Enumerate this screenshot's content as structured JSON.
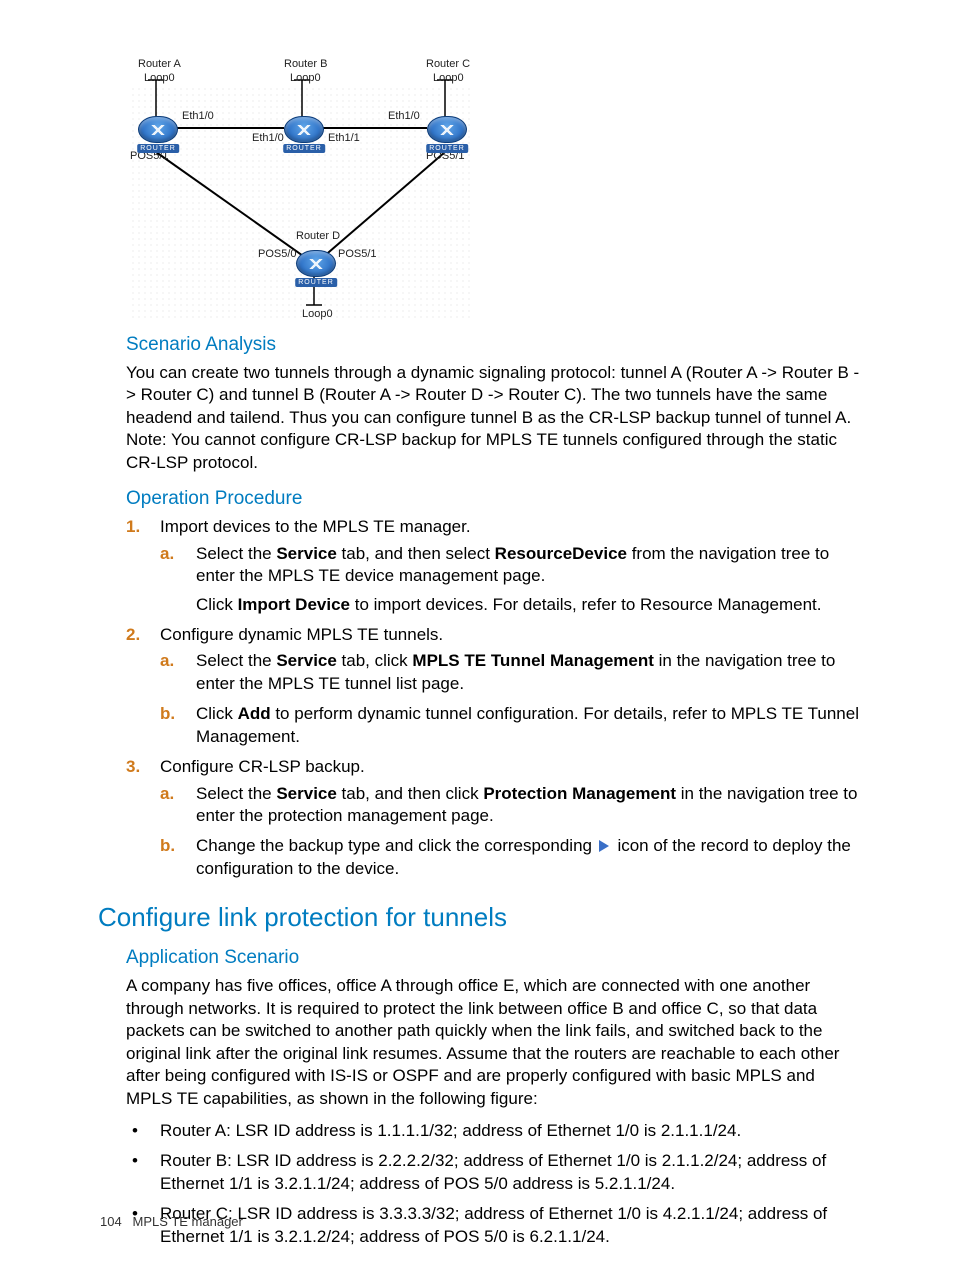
{
  "diagram": {
    "routers": {
      "a": {
        "name": "Router A",
        "loop": "Loop0",
        "eth_right": "Eth1/0",
        "pos": "POS5/1"
      },
      "b": {
        "name": "Router B",
        "loop": "Loop0",
        "eth_left": "Eth1/0",
        "eth_right": "Eth1/1",
        "eth_top_right": "Eth1/0"
      },
      "c": {
        "name": "Router C",
        "loop": "Loop0",
        "pos": "POS5/1"
      },
      "d": {
        "name": "Router D",
        "loop": "Loop0",
        "pos_left": "POS5/0",
        "pos_right": "POS5/1"
      }
    },
    "router_label": "ROUTER"
  },
  "sec1": {
    "h": "Scenario Analysis",
    "p": "You can create two tunnels through a dynamic signaling protocol: tunnel A (Router A -> Router B -> Router C) and tunnel B (Router A -> Router D -> Router C). The two tunnels have the same headend and tailend. Thus you can configure tunnel B as the CR-LSP backup tunnel of tunnel A. Note: You cannot configure CR-LSP backup for MPLS TE tunnels configured through the static CR-LSP protocol."
  },
  "sec2": {
    "h": "Operation Procedure",
    "steps": [
      {
        "t": "Import devices to the MPLS TE manager.",
        "subs": [
          {
            "pre": "Select the ",
            "b1": "Service",
            "mid1": " tab, and then select ",
            "b2": "Resource",
            "b3": "Device",
            "post1": " from the navigation tree to enter the MPLS TE device management page.",
            "extra_pre": "Click ",
            "extra_b": "Import Device",
            "extra_post": " to import devices. For details, refer to Resource Management."
          }
        ]
      },
      {
        "t": "Configure dynamic MPLS TE tunnels.",
        "subs": [
          {
            "pre": "Select the ",
            "b1": "Service",
            "mid1": " tab, click ",
            "b2": "MPLS TE Tunnel Management",
            "post1": " in the navigation tree to enter the MPLS TE tunnel list page."
          },
          {
            "pre": "Click ",
            "b1": "Add",
            "post1": " to perform dynamic tunnel configuration. For details, refer to MPLS TE Tunnel Management."
          }
        ]
      },
      {
        "t": "Configure CR-LSP backup.",
        "subs": [
          {
            "pre": "Select the ",
            "b1": "Service",
            "mid1": " tab, and then click ",
            "b2": "Protection Management",
            "post1": " in the navigation tree to enter the protection management page."
          },
          {
            "pre": "Change the backup type and click the corresponding ",
            "icon": true,
            "post1": " icon of the record to deploy the configuration to the device."
          }
        ]
      }
    ]
  },
  "sec3": {
    "h": "Configure link protection for tunnels",
    "sub_h": "Application Scenario",
    "p": "A company has five offices, office A through office E, which are connected with one another through networks. It is required to protect the link between office B and office C, so that data packets can be switched to another path quickly when the link fails, and switched back to the original link after the original link resumes. Assume that the routers are reachable to each other after being configured with IS-IS or OSPF and are properly configured with basic MPLS and MPLS TE capabilities, as shown in the following figure:",
    "bullets": [
      "Router A: LSR ID address is 1.1.1.1/32; address of Ethernet 1/0 is 2.1.1.1/24.",
      "Router B: LSR ID address is 2.2.2.2/32; address of Ethernet 1/0 is 2.1.1.2/24; address of Ethernet 1/1 is 3.2.1.1/24; address of POS 5/0 address is 5.2.1.1/24.",
      "Router C: LSR ID address is 3.3.3.3/32; address of Ethernet 1/0 is 4.2.1.1/24; address of Ethernet 1/1 is 3.2.1.2/24; address of POS 5/0 is 6.2.1.1/24."
    ]
  },
  "footer": {
    "page": "104",
    "chapter": "MPLS TE manager"
  }
}
